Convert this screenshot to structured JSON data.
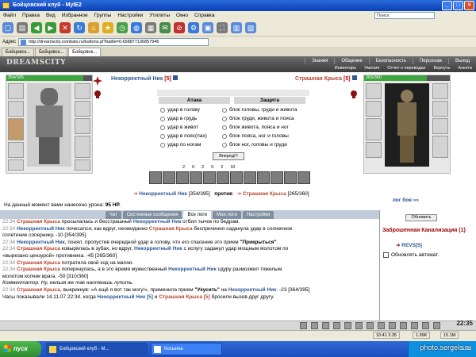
{
  "window": {
    "title": "Бойцовский клуб - MyIE2"
  },
  "menu": [
    "Файл",
    "Правка",
    "Вид",
    "Избранное",
    "Группы",
    "Настройки",
    "Утилиты",
    "Окно",
    "Справка"
  ],
  "search_placeholder": "Поиск",
  "address": {
    "label": "Адрес",
    "url": "http://dreamscity.combats.ru/buttons.pl?battle=0.658877136857946"
  },
  "browser_tabs": [
    "Бойцовск...",
    "Бойцовск...",
    "Бойцовск..."
  ],
  "game": {
    "logo": "DREAMSCITY",
    "nav_top": [
      "Знания",
      "Общение",
      "Безопасность",
      "Персонаж",
      "Выход"
    ],
    "nav_sub": [
      "Инвентарь",
      "Умения",
      "Отчет о переводах",
      "Вернуть",
      "Анкета"
    ],
    "player": {
      "name": "Некорректный Ник",
      "level": "[5]",
      "hp": "354/395",
      "hp_fraction": 0.896
    },
    "enemy": {
      "name": "Страшная Крыса",
      "level": "[5]",
      "hp": "265/360",
      "hp_fraction": 0.736
    },
    "attack_header": "Атака",
    "defense_header": "Защита",
    "attack_options": [
      "удар в голову",
      "удар в грудь",
      "удар в живот",
      "удар в пояс(пах)",
      "удар по ногам"
    ],
    "defense_options": [
      "блок головы, груди и живота",
      "блок груди, живота и пояса",
      "блок живота, пояса и ног",
      "блок пояса, ног и головы",
      "блок ног, головы и груди"
    ],
    "go_button": "Вперед!!!",
    "counters": [
      "2",
      "0",
      "2",
      "0",
      "2",
      "10"
    ],
    "vs": {
      "player": "Некорректный Ник",
      "player_hp": "[354/395]",
      "word": "против",
      "enemy": "Страшная Крыса",
      "enemy_hp": "[265/360]"
    },
    "damage": {
      "label": "На данный момент вами нанесено урона:",
      "value": "95 HP."
    },
    "log_link": "лог боя »»"
  },
  "chat": {
    "tabs": [
      "Чат",
      "Системные сообщения",
      "Все логи",
      "Мои логи",
      "Настройки"
    ],
    "active_tab": "Все логи",
    "lines": [
      [
        {
          "t": "22:34 ",
          "c": "time"
        },
        {
          "t": "Страшная Крыса",
          "c": "e"
        },
        {
          "t": " просыпалась и бесстрашный "
        },
        {
          "t": "Некорректный Ник",
          "c": "n"
        },
        {
          "t": " отбил тычок по бедрам."
        }
      ],
      [
        {
          "t": "22:34 ",
          "c": "time"
        },
        {
          "t": "Некорректный Ник",
          "c": "n"
        },
        {
          "t": " почесался, как вдруг, неожиданно "
        },
        {
          "t": "Страшная Крыса",
          "c": "e"
        },
        {
          "t": " беспричинно саданула удар в солнечное"
        }
      ],
      [
        {
          "t": "сплетение сопернику. -10 [354/395]"
        }
      ],
      [
        {
          "t": "22:34 ",
          "c": "time"
        },
        {
          "t": "Некорректный Ник",
          "c": "n"
        },
        {
          "t": ", понял, пропустив очередной удар в голову, что его спасение это прием "
        },
        {
          "t": "\"Прикрыться\"",
          "c": "b"
        },
        {
          "t": "."
        }
      ],
      [
        {
          "t": "22:34 ",
          "c": "time"
        },
        {
          "t": "Страшная Крыса",
          "c": "e"
        },
        {
          "t": " ковырялась в зубах, но вдруг, "
        },
        {
          "t": "Некорректный Ник",
          "c": "n"
        },
        {
          "t": " с испугу саданул удар мощным молотом по"
        }
      ],
      [
        {
          "t": "«вырезано цензурой» противника. -45 [265/360]"
        }
      ],
      [
        {
          "t": "22:34 ",
          "c": "time"
        },
        {
          "t": "Страшная Крыса",
          "c": "e"
        },
        {
          "t": " потратила свой ход на магию."
        }
      ],
      [
        {
          "t": "22:34 ",
          "c": "time"
        },
        {
          "t": "Страшная Крыса",
          "c": "e"
        },
        {
          "t": " поперхнулась, а в это время мужественный "
        },
        {
          "t": "Некорректный Ник",
          "c": "n"
        },
        {
          "t": " сдуру размозжил тяжелым"
        }
      ],
      [
        {
          "t": "молотом копчик врага. -50 [310/360]"
        }
      ],
      [
        {
          "t": "Комментатор: Ну, нельзя же так наотмашь лупить.",
          "c": "i"
        }
      ],
      [
        {
          "t": "22:34 ",
          "c": "time"
        },
        {
          "t": "Страшная Крыса",
          "c": "e"
        },
        {
          "t": ", выкрикнув: «А ещё я вот так могу!», применила прием "
        },
        {
          "t": "\"Укусить\"",
          "c": "b"
        },
        {
          "t": " на "
        },
        {
          "t": "Некорректный Ник",
          "c": "n"
        },
        {
          "t": ". -23 [364/395]"
        }
      ],
      [
        {
          "t": "Часы показывали 14.11.07 22:34, когда "
        },
        {
          "t": "Некорректный Ник [5]",
          "c": "n"
        },
        {
          "t": " и "
        },
        {
          "t": "Страшная Крыса [5]",
          "c": "e"
        },
        {
          "t": " бросили вызов друг другу."
        }
      ]
    ]
  },
  "side": {
    "refresh_button": "Обновить",
    "location": "Заброшенная Канализация (1)",
    "user": "REVS[5]",
    "auto_update_label": "Обновлять автомат."
  },
  "clock": "22:35",
  "status": {
    "time": "10:41 3.35",
    "speed": "1.99K",
    "speed2": "15.1M"
  },
  "taskbar": {
    "start": "пуск",
    "tasks": [
      "Бойцовский клуб - M...",
      "Косынка"
    ],
    "time": "5:33"
  },
  "watermark": "photo.sergels.ru"
}
